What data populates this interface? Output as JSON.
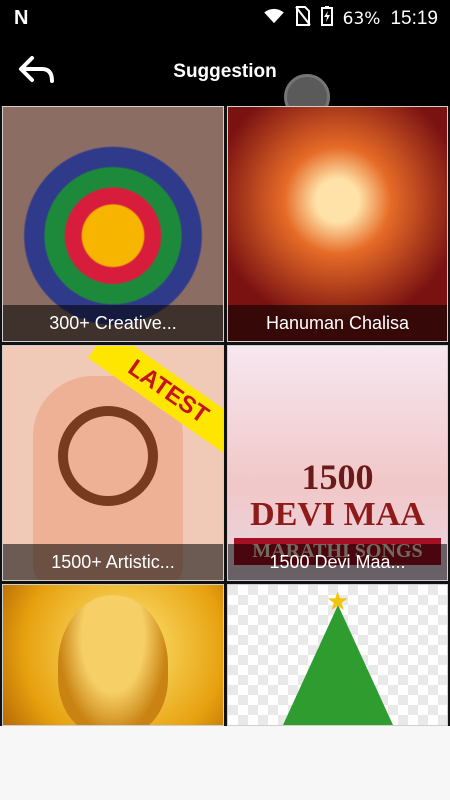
{
  "status_bar": {
    "carrier_logo": "N",
    "battery": "63%",
    "time": "15:19",
    "icons": [
      "wifi-icon",
      "no-sim-icon",
      "battery-charging-icon"
    ]
  },
  "app_bar": {
    "title": "Suggestion",
    "back_icon": "back-arrow-icon"
  },
  "grid": {
    "items": [
      {
        "label": "300+ Creative..."
      },
      {
        "label": "Hanuman Chalisa"
      },
      {
        "label": "1500+ Artistic...",
        "badge": "LATEST"
      },
      {
        "label": "1500 Devi Maa...",
        "art_text": [
          "1500",
          "DEVI MAA",
          "MARATHI SONGS"
        ]
      },
      {
        "label": ""
      },
      {
        "label": ""
      }
    ]
  }
}
